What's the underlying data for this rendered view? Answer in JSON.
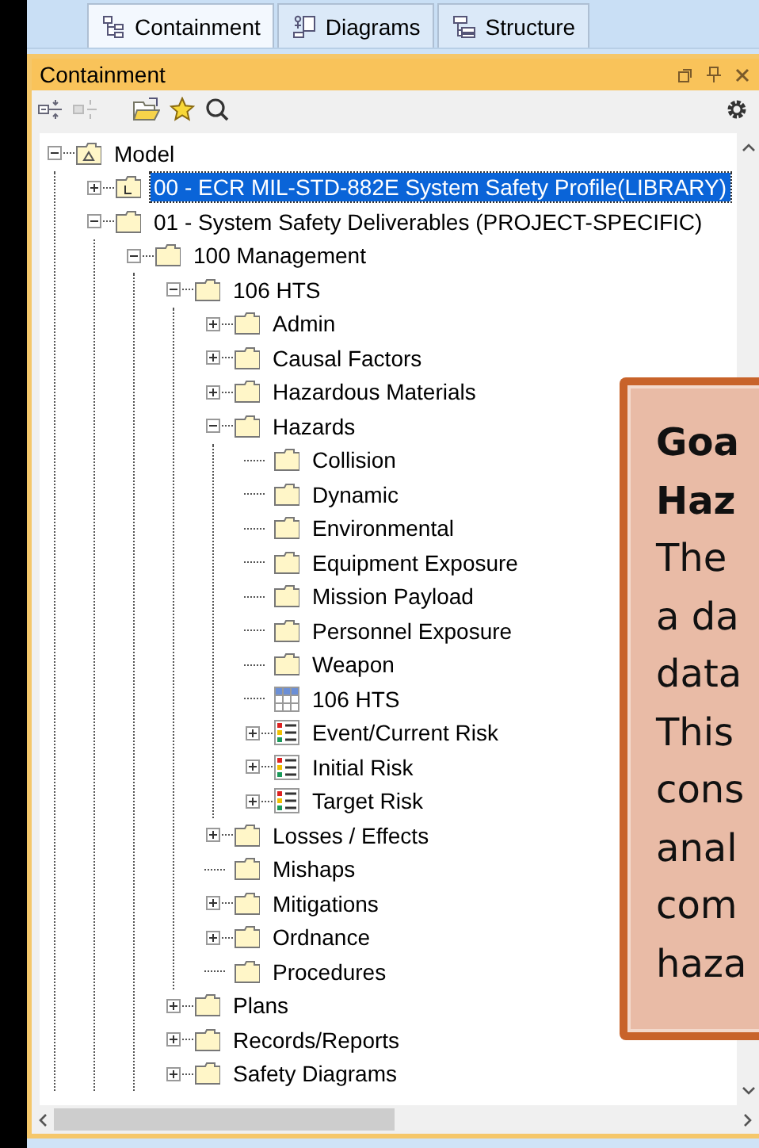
{
  "tabs": [
    {
      "label": "Containment",
      "kind": "containment",
      "selected": true
    },
    {
      "label": "Diagrams",
      "kind": "diagrams",
      "selected": false
    },
    {
      "label": "Structure",
      "kind": "structure",
      "selected": false
    }
  ],
  "panel": {
    "title": "Containment"
  },
  "tree": {
    "items": [
      {
        "label": "Model",
        "kind": "model",
        "expandable": true,
        "expanded": true,
        "selected": false,
        "children": [
          {
            "label": "00 - ECR MIL-STD-882E System Safety Profile(LIBRARY)",
            "kind": "library",
            "expandable": true,
            "expanded": false,
            "selected": true
          },
          {
            "label": "01 - System Safety Deliverables (PROJECT-SPECIFIC)",
            "kind": "folder",
            "expandable": true,
            "expanded": true,
            "selected": false,
            "children": [
              {
                "label": "100 Management",
                "kind": "folder",
                "expandable": true,
                "expanded": true,
                "selected": false,
                "children": [
                  {
                    "label": "106 HTS",
                    "kind": "folder",
                    "expandable": true,
                    "expanded": true,
                    "selected": false,
                    "children": [
                      {
                        "label": "Admin",
                        "kind": "folder",
                        "expandable": true,
                        "expanded": false,
                        "selected": false
                      },
                      {
                        "label": "Causal Factors",
                        "kind": "folder",
                        "expandable": true,
                        "expanded": false,
                        "selected": false
                      },
                      {
                        "label": "Hazardous Materials",
                        "kind": "folder",
                        "expandable": true,
                        "expanded": false,
                        "selected": false
                      },
                      {
                        "label": "Hazards",
                        "kind": "folder",
                        "expandable": true,
                        "expanded": true,
                        "selected": false,
                        "children": [
                          {
                            "label": "Collision",
                            "kind": "folder",
                            "expandable": false,
                            "expanded": false,
                            "selected": false
                          },
                          {
                            "label": "Dynamic",
                            "kind": "folder",
                            "expandable": false,
                            "expanded": false,
                            "selected": false
                          },
                          {
                            "label": "Environmental",
                            "kind": "folder",
                            "expandable": false,
                            "expanded": false,
                            "selected": false
                          },
                          {
                            "label": "Equipment Exposure",
                            "kind": "folder",
                            "expandable": false,
                            "expanded": false,
                            "selected": false
                          },
                          {
                            "label": "Mission Payload",
                            "kind": "folder",
                            "expandable": false,
                            "expanded": false,
                            "selected": false
                          },
                          {
                            "label": "Personnel Exposure",
                            "kind": "folder",
                            "expandable": false,
                            "expanded": false,
                            "selected": false
                          },
                          {
                            "label": "Weapon",
                            "kind": "folder",
                            "expandable": false,
                            "expanded": false,
                            "selected": false
                          },
                          {
                            "label": "106 HTS",
                            "kind": "table",
                            "expandable": false,
                            "expanded": false,
                            "selected": false
                          },
                          {
                            "label": "Event/Current Risk",
                            "kind": "matrix",
                            "expandable": true,
                            "expanded": false,
                            "selected": false
                          },
                          {
                            "label": "Initial Risk",
                            "kind": "matrix",
                            "expandable": true,
                            "expanded": false,
                            "selected": false
                          },
                          {
                            "label": "Target Risk",
                            "kind": "matrix",
                            "expandable": true,
                            "expanded": false,
                            "selected": false
                          }
                        ]
                      },
                      {
                        "label": "Losses / Effects",
                        "kind": "folder",
                        "expandable": true,
                        "expanded": false,
                        "selected": false
                      },
                      {
                        "label": "Mishaps",
                        "kind": "folder",
                        "expandable": false,
                        "expanded": false,
                        "selected": false
                      },
                      {
                        "label": "Mitigations",
                        "kind": "folder",
                        "expandable": true,
                        "expanded": false,
                        "selected": false
                      },
                      {
                        "label": "Ordnance",
                        "kind": "folder",
                        "expandable": true,
                        "expanded": false,
                        "selected": false
                      },
                      {
                        "label": "Procedures",
                        "kind": "folder",
                        "expandable": false,
                        "expanded": false,
                        "selected": false
                      }
                    ]
                  },
                  {
                    "label": "Plans",
                    "kind": "folder",
                    "expandable": true,
                    "expanded": false,
                    "selected": false
                  },
                  {
                    "label": "Records/Reports",
                    "kind": "folder",
                    "expandable": true,
                    "expanded": false,
                    "selected": false
                  },
                  {
                    "label": "Safety Diagrams",
                    "kind": "folder",
                    "expandable": true,
                    "expanded": false,
                    "selected": false
                  }
                ]
              }
            ]
          }
        ]
      }
    ]
  },
  "callout": {
    "lines": [
      {
        "text": "Goa",
        "bold": true
      },
      {
        "text": "Haz",
        "bold": true
      },
      {
        "text": "The",
        "bold": false
      },
      {
        "text": "a da",
        "bold": false
      },
      {
        "text": "data",
        "bold": false
      },
      {
        "text": "This",
        "bold": false
      },
      {
        "text": "cons",
        "bold": false
      },
      {
        "text": "anal",
        "bold": false
      },
      {
        "text": "com",
        "bold": false
      },
      {
        "text": "haza",
        "bold": false
      }
    ]
  }
}
